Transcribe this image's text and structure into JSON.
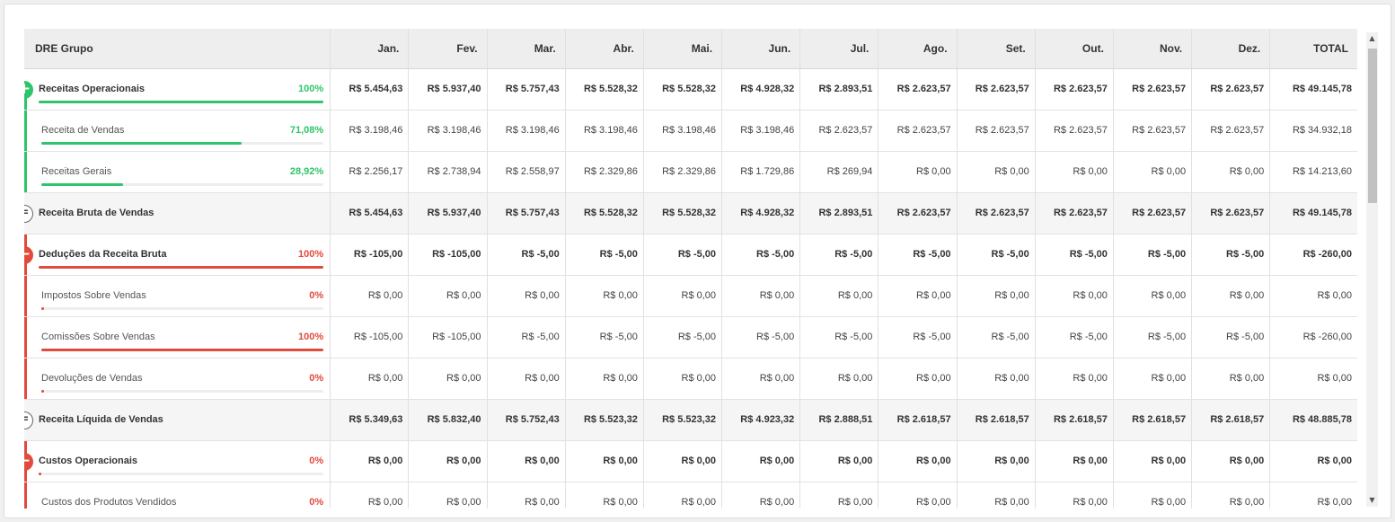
{
  "table": {
    "columns": [
      "DRE Grupo",
      "Jan.",
      "Fev.",
      "Mar.",
      "Abr.",
      "Mai.",
      "Jun.",
      "Jul.",
      "Ago.",
      "Set.",
      "Out.",
      "Nov.",
      "Dez.",
      "TOTAL"
    ],
    "rows": [
      {
        "label": "Receitas Operacionais",
        "pct": "100%",
        "progress": 1.0,
        "values": [
          "R$ 5.454,63",
          "R$ 5.937,40",
          "R$ 5.757,43",
          "R$ 5.528,32",
          "R$ 5.528,32",
          "R$ 4.928,32",
          "R$ 2.893,51",
          "R$ 2.623,57",
          "R$ 2.623,57",
          "R$ 2.623,57",
          "R$ 2.623,57",
          "R$ 2.623,57",
          "R$ 49.145,78"
        ]
      },
      {
        "label": "Receita de Vendas",
        "pct": "71,08%",
        "progress": 0.7108,
        "values": [
          "R$ 3.198,46",
          "R$ 3.198,46",
          "R$ 3.198,46",
          "R$ 3.198,46",
          "R$ 3.198,46",
          "R$ 3.198,46",
          "R$ 2.623,57",
          "R$ 2.623,57",
          "R$ 2.623,57",
          "R$ 2.623,57",
          "R$ 2.623,57",
          "R$ 2.623,57",
          "R$ 34.932,18"
        ]
      },
      {
        "label": "Receitas Gerais",
        "pct": "28,92%",
        "progress": 0.2892,
        "values": [
          "R$ 2.256,17",
          "R$ 2.738,94",
          "R$ 2.558,97",
          "R$ 2.329,86",
          "R$ 2.329,86",
          "R$ 1.729,86",
          "R$ 269,94",
          "R$ 0,00",
          "R$ 0,00",
          "R$ 0,00",
          "R$ 0,00",
          "R$ 0,00",
          "R$ 14.213,60"
        ]
      },
      {
        "label": "Receita Bruta de Vendas",
        "values": [
          "R$ 5.454,63",
          "R$ 5.937,40",
          "R$ 5.757,43",
          "R$ 5.528,32",
          "R$ 5.528,32",
          "R$ 4.928,32",
          "R$ 2.893,51",
          "R$ 2.623,57",
          "R$ 2.623,57",
          "R$ 2.623,57",
          "R$ 2.623,57",
          "R$ 2.623,57",
          "R$ 49.145,78"
        ]
      },
      {
        "label": "Deduções da Receita Bruta",
        "pct": "100%",
        "progress": 1.0,
        "values": [
          "R$ -105,00",
          "R$ -105,00",
          "R$ -5,00",
          "R$ -5,00",
          "R$ -5,00",
          "R$ -5,00",
          "R$ -5,00",
          "R$ -5,00",
          "R$ -5,00",
          "R$ -5,00",
          "R$ -5,00",
          "R$ -5,00",
          "R$ -260,00"
        ]
      },
      {
        "label": "Impostos Sobre Vendas",
        "pct": "0%",
        "progress": 0.0,
        "values": [
          "R$ 0,00",
          "R$ 0,00",
          "R$ 0,00",
          "R$ 0,00",
          "R$ 0,00",
          "R$ 0,00",
          "R$ 0,00",
          "R$ 0,00",
          "R$ 0,00",
          "R$ 0,00",
          "R$ 0,00",
          "R$ 0,00",
          "R$ 0,00"
        ]
      },
      {
        "label": "Comissões Sobre Vendas",
        "pct": "100%",
        "progress": 1.0,
        "values": [
          "R$ -105,00",
          "R$ -105,00",
          "R$ -5,00",
          "R$ -5,00",
          "R$ -5,00",
          "R$ -5,00",
          "R$ -5,00",
          "R$ -5,00",
          "R$ -5,00",
          "R$ -5,00",
          "R$ -5,00",
          "R$ -5,00",
          "R$ -260,00"
        ]
      },
      {
        "label": "Devoluções de Vendas",
        "pct": "0%",
        "progress": 0.0,
        "values": [
          "R$ 0,00",
          "R$ 0,00",
          "R$ 0,00",
          "R$ 0,00",
          "R$ 0,00",
          "R$ 0,00",
          "R$ 0,00",
          "R$ 0,00",
          "R$ 0,00",
          "R$ 0,00",
          "R$ 0,00",
          "R$ 0,00",
          "R$ 0,00"
        ]
      },
      {
        "label": "Receita Líquida de Vendas",
        "values": [
          "R$ 5.349,63",
          "R$ 5.832,40",
          "R$ 5.752,43",
          "R$ 5.523,32",
          "R$ 5.523,32",
          "R$ 4.923,32",
          "R$ 2.888,51",
          "R$ 2.618,57",
          "R$ 2.618,57",
          "R$ 2.618,57",
          "R$ 2.618,57",
          "R$ 2.618,57",
          "R$ 48.885,78"
        ]
      },
      {
        "label": "Custos Operacionais",
        "pct": "0%",
        "progress": 0.0,
        "values": [
          "R$ 0,00",
          "R$ 0,00",
          "R$ 0,00",
          "R$ 0,00",
          "R$ 0,00",
          "R$ 0,00",
          "R$ 0,00",
          "R$ 0,00",
          "R$ 0,00",
          "R$ 0,00",
          "R$ 0,00",
          "R$ 0,00",
          "R$ 0,00"
        ]
      },
      {
        "label": "Custos dos Produtos Vendidos",
        "pct": "0%",
        "progress": 0.0,
        "values": [
          "R$ 0,00",
          "R$ 0,00",
          "R$ 0,00",
          "R$ 0,00",
          "R$ 0,00",
          "R$ 0,00",
          "R$ 0,00",
          "R$ 0,00",
          "R$ 0,00",
          "R$ 0,00",
          "R$ 0,00",
          "R$ 0,00",
          "R$ 0,00"
        ]
      }
    ]
  },
  "icons": {
    "plus": "+",
    "minus": "−",
    "equals": "=",
    "scroll_up": "▲",
    "scroll_down": "▼"
  },
  "colors": {
    "revenue": "#2ec56a",
    "deduction": "#e14a3c"
  }
}
